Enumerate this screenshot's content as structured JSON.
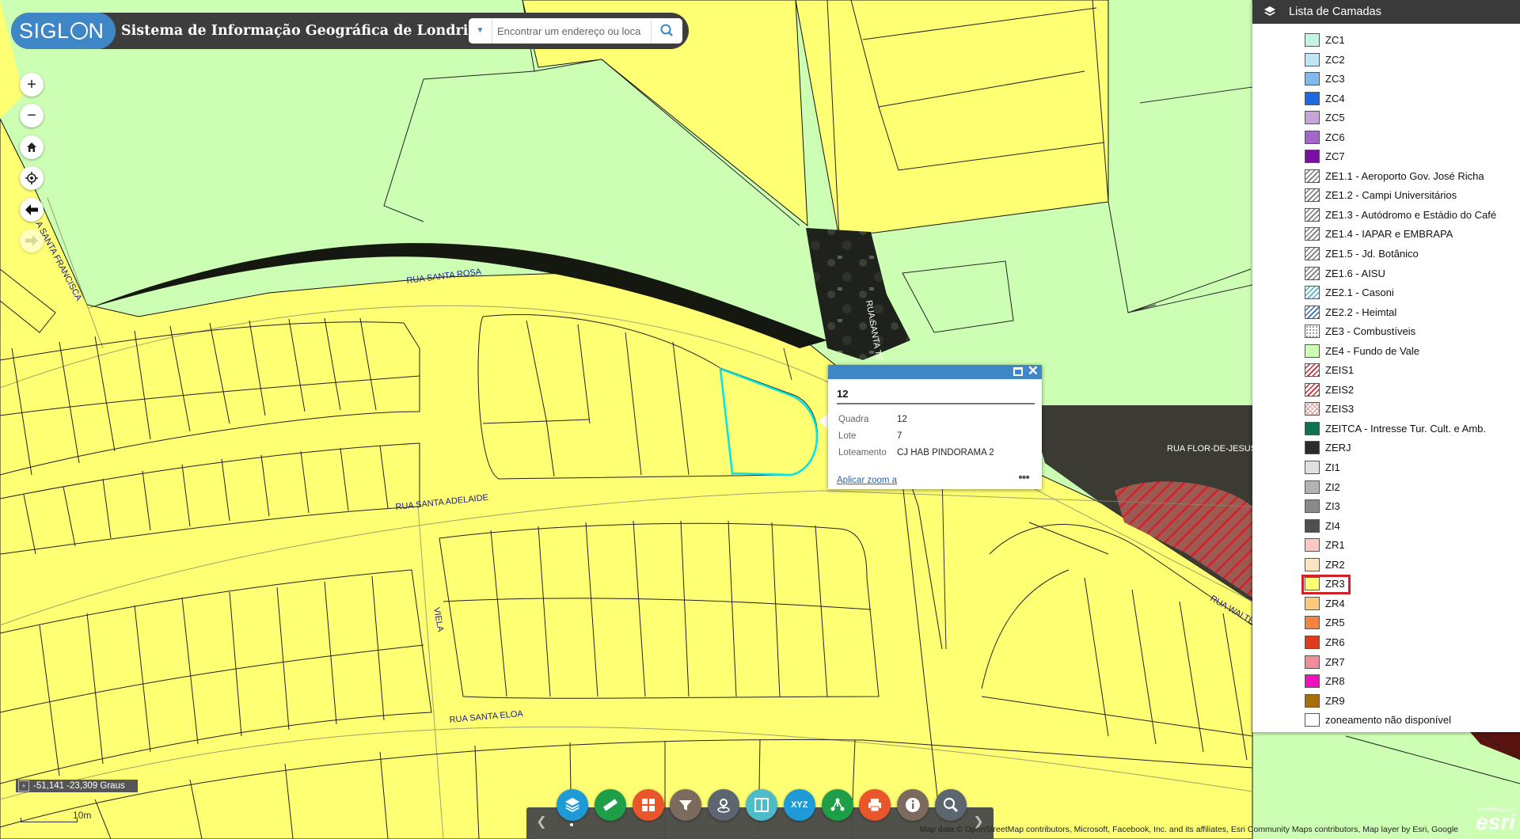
{
  "header": {
    "logo_text": "SIGL",
    "logo_text2": "N",
    "title": "Sistema de Informação Geográfica de Londrina",
    "search_placeholder": "Encontrar um endereço ou loca"
  },
  "map": {
    "streets": {
      "santa_rosa": "RUA SANTA ROSA",
      "santa_adelaide": "RUA SANTA ADELAIDE",
      "santa_eloa": "RUA SANTA ELOA",
      "viela": "VIELA",
      "santa_francisca": "A SANTA FRANCISCA",
      "santa_te": "RUA SANTA TE",
      "flor_de_jesus": "RUA FLOR-DE-JESUS",
      "walter": "RUA WALTE"
    },
    "colors": {
      "zr3_yellow": "#ffff73",
      "ze4_green": "#ccffb3",
      "selection": "#00e6e6",
      "zeis_hatch": "#d42027"
    }
  },
  "controls": {
    "zoom_in_icon": "plus-icon",
    "zoom_out_icon": "minus-icon",
    "home_icon": "home-icon",
    "locate_icon": "locate-icon",
    "back_icon": "arrow-left-icon",
    "forward_icon": "arrow-right-icon"
  },
  "layer_panel": {
    "title": "Lista de Camadas",
    "items": [
      {
        "label": "ZC1",
        "color": "#c2f5e0"
      },
      {
        "label": "ZC2",
        "color": "#bfe6f7"
      },
      {
        "label": "ZC3",
        "color": "#80b8f0"
      },
      {
        "label": "ZC4",
        "color": "#1a6ae6"
      },
      {
        "label": "ZC5",
        "color": "#c8a4dd"
      },
      {
        "label": "ZC6",
        "color": "#a266cc"
      },
      {
        "label": "ZC7",
        "color": "#7b0da6"
      },
      {
        "label": "ZE1.1 - Aeroporto Gov. José Richa",
        "pattern": "hatch-gray"
      },
      {
        "label": "ZE1.2 - Campi Universitários",
        "pattern": "hatch-gray"
      },
      {
        "label": "ZE1.3 - Autódromo e Estádio do Café",
        "pattern": "hatch-gray"
      },
      {
        "label": "ZE1.4 - IAPAR e EMBRAPA",
        "pattern": "hatch-gray"
      },
      {
        "label": "ZE1.5 - Jd. Botânico",
        "pattern": "hatch-gray"
      },
      {
        "label": "ZE1.6 - AISU",
        "pattern": "hatch-gray"
      },
      {
        "label": "ZE2.1 - Casoni",
        "pattern": "hatch-cyan"
      },
      {
        "label": "ZE2.2 - Heimtal",
        "pattern": "hatch-blue"
      },
      {
        "label": "ZE3 - Combustíveis",
        "pattern": "dots"
      },
      {
        "label": "ZE4 - Fundo de Vale",
        "color": "#ccffb3"
      },
      {
        "label": "ZEIS1",
        "pattern": "hatch-red"
      },
      {
        "label": "ZEIS2",
        "pattern": "hatch-red"
      },
      {
        "label": "ZEIS3",
        "pattern": "cross-red"
      },
      {
        "label": "ZEITCA - Intresse Tur. Cult. e Amb.",
        "color": "#0a7550"
      },
      {
        "label": "ZERJ",
        "color": "#2b2b2b"
      },
      {
        "label": "ZI1",
        "color": "#e0e0e0"
      },
      {
        "label": "ZI2",
        "color": "#b3b3b3"
      },
      {
        "label": "ZI3",
        "color": "#8a8a8a"
      },
      {
        "label": "ZI4",
        "color": "#4f4f4f"
      },
      {
        "label": "ZR1",
        "color": "#fac7c2"
      },
      {
        "label": "ZR2",
        "color": "#fce6bf"
      },
      {
        "label": "ZR3",
        "color": "#ffff73",
        "highlighted": true
      },
      {
        "label": "ZR4",
        "color": "#fbc97a"
      },
      {
        "label": "ZR5",
        "color": "#f5823d"
      },
      {
        "label": "ZR6",
        "color": "#e03a1a"
      },
      {
        "label": "ZR7",
        "color": "#f28c9a"
      },
      {
        "label": "ZR8",
        "color": "#f20fbf"
      },
      {
        "label": "ZR9",
        "color": "#a86f08"
      },
      {
        "label": "zoneamento não disponível",
        "color": "#ffffff"
      }
    ]
  },
  "popup": {
    "title": "12",
    "fields": [
      {
        "name": "Quadra",
        "value": "12"
      },
      {
        "name": "Lote",
        "value": "7"
      },
      {
        "name": "Loteamento",
        "value": "CJ HAB PINDORAMA 2"
      }
    ],
    "zoom_link": "Aplicar zoom a",
    "more": "•••"
  },
  "status": {
    "coordinates": "-51,141 -23,309 Graus",
    "scale": "10m"
  },
  "toolbar": {
    "buttons": [
      {
        "name": "layers-tool",
        "icon": "layers-icon",
        "color": "#1e9ad6"
      },
      {
        "name": "measure-tool",
        "icon": "ruler-icon",
        "color": "#1f9e48"
      },
      {
        "name": "basemap-tool",
        "icon": "grid-icon",
        "color": "#e8562a"
      },
      {
        "name": "filter-tool",
        "icon": "filter-icon",
        "color": "#7d6a5e"
      },
      {
        "name": "draw-tool",
        "icon": "pin-draw-icon",
        "color": "#5c6670"
      },
      {
        "name": "swipe-tool",
        "icon": "swipe-icon",
        "color": "#4cbcc9"
      },
      {
        "name": "xyz-tool",
        "icon": "xyz-icon",
        "label": "XYZ",
        "color": "#1e9ad6"
      },
      {
        "name": "share-tool",
        "icon": "share-icon",
        "color": "#1f9e48"
      },
      {
        "name": "print-tool",
        "icon": "print-icon",
        "color": "#e8562a"
      },
      {
        "name": "about-tool",
        "icon": "info-icon",
        "color": "#7d6a5e"
      },
      {
        "name": "query-tool",
        "icon": "zoom-query-icon",
        "color": "#5c6670"
      }
    ]
  },
  "attribution": "Map data © OpenStreetMap contributors, Microsoft, Facebook, Inc. and its affiliates, Esri Community Maps contributors, Map layer by Esri, Google",
  "esri": {
    "powered": "POWERED BY",
    "logo": "esri"
  }
}
